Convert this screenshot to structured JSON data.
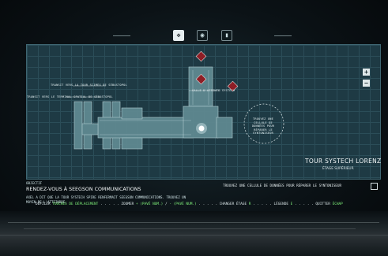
{
  "top_nav": {
    "icons": [
      "move-icon",
      "map-icon",
      "inventory-icon"
    ]
  },
  "map": {
    "labels": {
      "transit_tower": "TRANSIT VERS LA TOUR SCIMEX DE SÉBASTOPOL",
      "transit_terminal": "TRANSIT VERS LE TERMINAL SPATIAL DE SÉBASTOPOL",
      "waiting_room": "SALLE D'ATTENTE SYSTECH",
      "data_cell": "TROUVEZ UNE CELLULE DE DONNÉES POUR RÉPARER LE SYNTONISEUR"
    },
    "zoom_in": "+",
    "zoom_out": "−",
    "tower_title": "TOUR SYSTECH LORENZ",
    "floor": "ÉTAGE SUPÉRIEUR"
  },
  "objective": {
    "label": "OBJECTIF",
    "title": "RENDEZ-VOUS À SEEGSON COMMUNICATIONS",
    "text": "AXEL A DIT QUE LA TOUR SYSTECH SPIRE RENFERMAIT SEEGSON COMMUNICATIONS. TROUVEZ UN MOYEN DE L'ATTEINDRE."
  },
  "task": {
    "text": "TROUVEZ UNE CELLULE DE DONNÉES POUR RÉPARER LE SYNTONISEUR"
  },
  "controls": {
    "scroll_label": "DÉFILER",
    "scroll_key": "TOUCHES DE DÉPLACEMENT",
    "dots1": " . . . . . ",
    "zoom_label": "ZOOMER",
    "zoom_key_in": "+ (PAVÉ NUM.)",
    "zoom_sep": "/",
    "zoom_key_out": "- (PAVÉ NUM.)",
    "dots2": " . . . . . ",
    "floor_label": "CHANGER ÉTAGE",
    "floor_key": "R",
    "dots3": " . . . . . ",
    "legend_label": "LÉGENDE",
    "legend_key": "E",
    "dots4": " . . . . . ",
    "quit_label": "QUITTER",
    "quit_key": "ÉCHAP"
  },
  "colors": {
    "map_bg": "#1e3a44",
    "structure": "#8fb6bd",
    "highlight_key": "#7ff07a",
    "marker": "#b3262e"
  }
}
